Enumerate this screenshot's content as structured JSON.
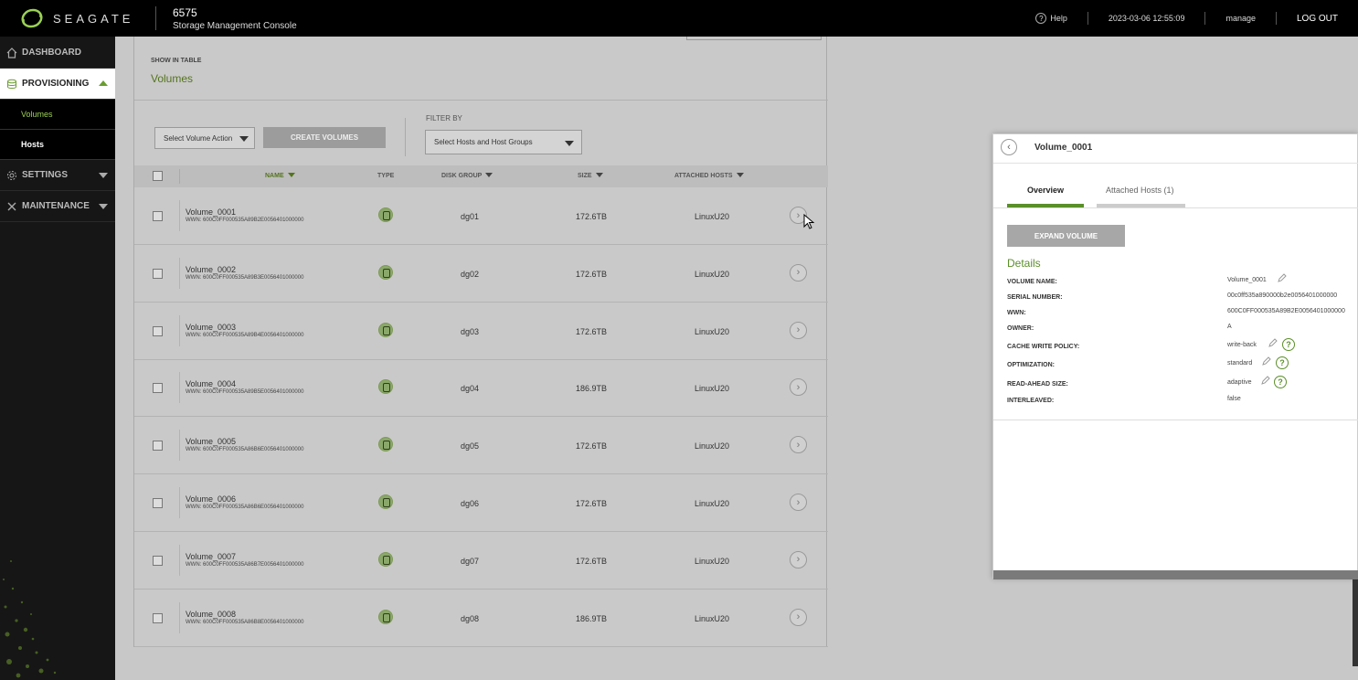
{
  "topbar": {
    "brand": "SEAGATE",
    "model": "6575",
    "product": "Storage Management Console",
    "help": "Help",
    "datetime": "2023-03-06 12:55:09",
    "user": "manage",
    "logout": "LOG OUT"
  },
  "sidebar": {
    "dashboard": "DASHBOARD",
    "provisioning": "PROVISIONING",
    "volumes": "Volumes",
    "hosts": "Hosts",
    "settings": "SETTINGS",
    "maintenance": "MAINTENANCE"
  },
  "main": {
    "show_in_table": "SHOW IN TABLE",
    "heading": "Volumes",
    "select_action": "Select Volume Action",
    "create_button": "CREATE VOLUMES",
    "filter_label": "FILTER BY",
    "filter_select": "Select Hosts and Host Groups",
    "columns": {
      "name": "NAME",
      "type": "TYPE",
      "disk_group": "DISK GROUP",
      "size": "SIZE",
      "attached_hosts": "ATTACHED HOSTS"
    },
    "rows": [
      {
        "name": "Volume_0001",
        "wwn": "WWN: 600C0FF000535A89B2E0056401000000",
        "disk_group": "dg01",
        "size": "172.6TB",
        "host": "LinuxU20"
      },
      {
        "name": "Volume_0002",
        "wwn": "WWN: 600C0FF000535A89B3E0056401000000",
        "disk_group": "dg02",
        "size": "172.6TB",
        "host": "LinuxU20"
      },
      {
        "name": "Volume_0003",
        "wwn": "WWN: 600C0FF000535A89B4E0056401000000",
        "disk_group": "dg03",
        "size": "172.6TB",
        "host": "LinuxU20"
      },
      {
        "name": "Volume_0004",
        "wwn": "WWN: 600C0FF000535A89B5E0056401000000",
        "disk_group": "dg04",
        "size": "186.9TB",
        "host": "LinuxU20"
      },
      {
        "name": "Volume_0005",
        "wwn": "WWN: 600C0FF000535A86B6E0056401000000",
        "disk_group": "dg05",
        "size": "172.6TB",
        "host": "LinuxU20"
      },
      {
        "name": "Volume_0006",
        "wwn": "WWN: 600C0FF000535A86B6E0056401000000",
        "disk_group": "dg06",
        "size": "172.6TB",
        "host": "LinuxU20"
      },
      {
        "name": "Volume_0007",
        "wwn": "WWN: 600C0FF000535A86B7E0056401000000",
        "disk_group": "dg07",
        "size": "172.6TB",
        "host": "LinuxU20"
      },
      {
        "name": "Volume_0008",
        "wwn": "WWN: 600C0FF000535A86B8E0056401000000",
        "disk_group": "dg08",
        "size": "186.9TB",
        "host": "LinuxU20"
      }
    ]
  },
  "detail": {
    "title": "Volume_0001",
    "tab_overview": "Overview",
    "tab_hosts": "Attached Hosts (1)",
    "expand_button": "EXPAND VOLUME",
    "details_heading": "Details",
    "fields": [
      {
        "label": "VOLUME NAME:",
        "value": "Volume_0001"
      },
      {
        "label": "SERIAL NUMBER:",
        "value": "00c0ff535a890000b2e0056401000000"
      },
      {
        "label": "WWN:",
        "value": "600C0FF000535A89B2E0056401000000"
      },
      {
        "label": "OWNER:",
        "value": "A"
      },
      {
        "label": "CACHE WRITE POLICY:",
        "value": "write-back"
      },
      {
        "label": "OPTIMIZATION:",
        "value": "standard"
      },
      {
        "label": "READ-AHEAD SIZE:",
        "value": "adaptive"
      },
      {
        "label": "INTERLEAVED:",
        "value": "false"
      }
    ],
    "help_glyph": "?",
    "back_glyph": "‹"
  },
  "glyphs": {
    "row_go": "›"
  },
  "colors": {
    "accent": "#5b8f29",
    "topbar": "#000000",
    "sidebar": "#161616"
  }
}
